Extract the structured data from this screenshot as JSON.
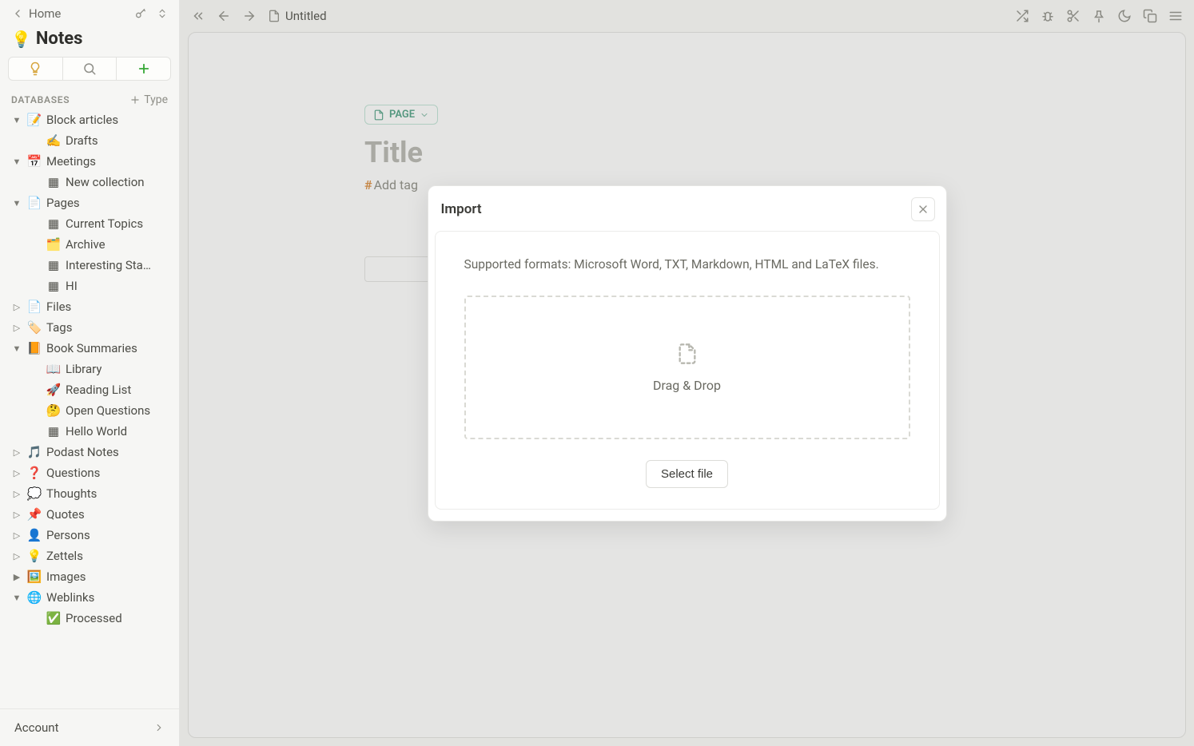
{
  "sidebar": {
    "home_label": "Home",
    "workspace_emoji": "💡",
    "workspace_title": "Notes",
    "section_label": "DATABASES",
    "add_type_label": "Type",
    "account_label": "Account",
    "tree": [
      {
        "depth": 0,
        "chev": "down",
        "icon": "📝",
        "label": "Block articles"
      },
      {
        "depth": 1,
        "chev": "",
        "icon": "✍️",
        "label": "Drafts"
      },
      {
        "depth": 0,
        "chev": "down",
        "icon": "📅",
        "label": "Meetings"
      },
      {
        "depth": 1,
        "chev": "",
        "icon": "▦",
        "label": "New collection"
      },
      {
        "depth": 0,
        "chev": "down",
        "icon": "📄",
        "label": "Pages"
      },
      {
        "depth": 1,
        "chev": "",
        "icon": "▦",
        "label": "Current Topics"
      },
      {
        "depth": 1,
        "chev": "",
        "icon": "🗂️",
        "label": "Archive"
      },
      {
        "depth": 1,
        "chev": "",
        "icon": "▦",
        "label": "Interesting Sta…"
      },
      {
        "depth": 1,
        "chev": "",
        "icon": "▦",
        "label": "HI"
      },
      {
        "depth": 0,
        "chev": "right",
        "icon": "📄",
        "label": "Files"
      },
      {
        "depth": 0,
        "chev": "right",
        "icon": "🏷️",
        "label": "Tags"
      },
      {
        "depth": 0,
        "chev": "down",
        "icon": "📙",
        "label": "Book Summaries"
      },
      {
        "depth": 1,
        "chev": "",
        "icon": "📖",
        "label": "Library"
      },
      {
        "depth": 1,
        "chev": "",
        "icon": "🚀",
        "label": "Reading List"
      },
      {
        "depth": 1,
        "chev": "",
        "icon": "🤔",
        "label": "Open Questions"
      },
      {
        "depth": 1,
        "chev": "",
        "icon": "▦",
        "label": "Hello World"
      },
      {
        "depth": 0,
        "chev": "right",
        "icon": "🎵",
        "label": "Podast Notes"
      },
      {
        "depth": 0,
        "chev": "right",
        "icon": "❓",
        "label": "Questions"
      },
      {
        "depth": 0,
        "chev": "right",
        "icon": "💭",
        "label": "Thoughts"
      },
      {
        "depth": 0,
        "chev": "right",
        "icon": "📌",
        "label": "Quotes"
      },
      {
        "depth": 0,
        "chev": "right",
        "icon": "👤",
        "label": "Persons"
      },
      {
        "depth": 0,
        "chev": "right",
        "icon": "💡",
        "label": "Zettels"
      },
      {
        "depth": 0,
        "chev": "right-filled",
        "icon": "🖼️",
        "label": "Images"
      },
      {
        "depth": 0,
        "chev": "down",
        "icon": "🌐",
        "label": "Weblinks"
      },
      {
        "depth": 1,
        "chev": "",
        "icon": "✅",
        "label": "Processed"
      }
    ]
  },
  "topbar": {
    "doc_title": "Untitled"
  },
  "page": {
    "type_label": "PAGE",
    "title_placeholder": "Title",
    "add_tag_label": "Add tag"
  },
  "modal": {
    "title": "Import",
    "supported_text": "Supported formats: Microsoft Word, TXT, Markdown, HTML and LaTeX files.",
    "dropzone_label": "Drag & Drop",
    "select_file_label": "Select file"
  }
}
